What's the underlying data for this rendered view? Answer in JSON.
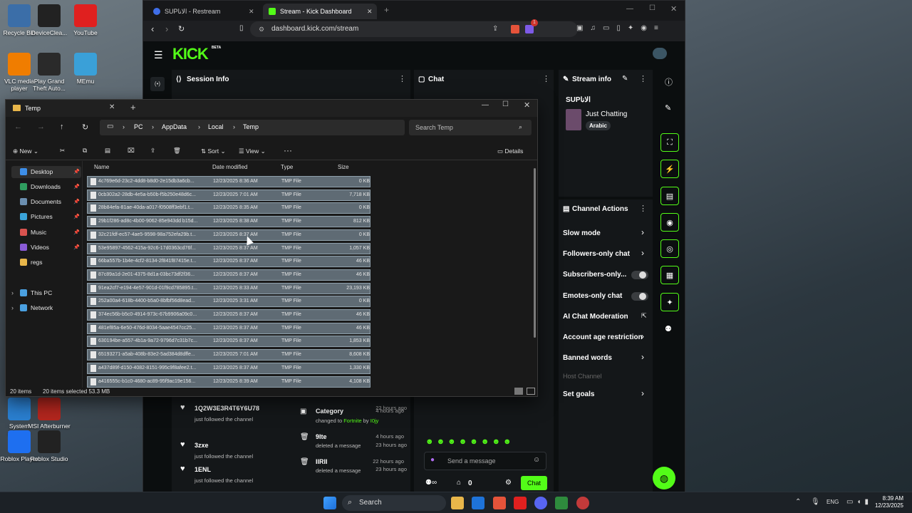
{
  "desktop": {
    "icons_left_top": [
      {
        "label": "Recycle Bin"
      },
      {
        "label": "DeviceClea..."
      },
      {
        "label": "YouTube"
      },
      {
        "label": "VLC media player"
      },
      {
        "label": "Play Grand Theft Auto..."
      },
      {
        "label": "MEmu"
      }
    ],
    "icons_left_bottom": [
      {
        "label": "System Explorer"
      },
      {
        "label": "MSI Afterburner"
      },
      {
        "label": "Roblox Player"
      },
      {
        "label": "Roblox Studio"
      }
    ]
  },
  "browser": {
    "tabs": [
      {
        "title": "SUPالانا - Restream"
      },
      {
        "title": "Stream - Kick Dashboard"
      }
    ],
    "address": "dashboard.kick.com/stream",
    "notification_count": "1"
  },
  "kick": {
    "logo": "KICK",
    "logo_badge": "BETA",
    "session_info": "Session Info",
    "chat_title": "Chat",
    "stream_info_title": "Stream info",
    "stream_title": "SUPالانا",
    "category": "Just Chatting",
    "language": "Arabic",
    "channel_actions_title": "Channel Actions",
    "actions": [
      {
        "label": "Slow mode"
      },
      {
        "label": "Followers-only chat"
      },
      {
        "label": "Subscribers-only..."
      },
      {
        "label": "Emotes-only chat"
      },
      {
        "label": "AI Chat Moderation"
      },
      {
        "label": "Account age restriction"
      },
      {
        "label": "Banned words"
      },
      {
        "label": "Host Channel"
      },
      {
        "label": "Set goals"
      }
    ],
    "followers": [
      {
        "name": "1Q2W3E3R4T6Y6U78",
        "time": "22 hours ago",
        "action": "just followed the channel"
      },
      {
        "name": "3zxe",
        "time": "23 hours ago",
        "action": "just followed the channel"
      },
      {
        "name": "1ENL",
        "time": "23 hours ago",
        "action": "just followed the channel"
      }
    ],
    "events": [
      {
        "title": "Category",
        "time": "4 hours ago",
        "detail_prefix": "changed to",
        "detail_game": "Fortnite",
        "detail_by": "by",
        "detail_user": "I0jy"
      },
      {
        "title": "9Ite",
        "time": "4 hours ago",
        "detail": "deleted a message"
      },
      {
        "title": "IlRII",
        "time": "22 hours ago",
        "detail": "deleted a message"
      }
    ],
    "chat_placeholder": "Send a message",
    "chat_button": "Chat",
    "viewer_count": "0"
  },
  "explorer": {
    "window_title": "Temp",
    "breadcrumb": [
      "PC",
      "AppData",
      "Local",
      "Temp"
    ],
    "search_placeholder": "Search Temp",
    "toolbar": {
      "new": "New",
      "sort": "Sort",
      "view": "View",
      "details": "Details"
    },
    "columns": [
      "Name",
      "Date modified",
      "Type",
      "Size"
    ],
    "nav": [
      {
        "label": "Desktop",
        "color": "#3d8ee8"
      },
      {
        "label": "Downloads",
        "color": "#2f9e5f"
      },
      {
        "label": "Documents",
        "color": "#6b8fb0"
      },
      {
        "label": "Pictures",
        "color": "#3aa3d8"
      },
      {
        "label": "Music",
        "color": "#d9534f"
      },
      {
        "label": "Videos",
        "color": "#8a5bd6"
      },
      {
        "label": "regs",
        "color": "#e8b64a"
      },
      {
        "label": "This PC",
        "color": "#4aa0e0"
      },
      {
        "label": "Network",
        "color": "#4aa0e0"
      }
    ],
    "files": [
      {
        "name": "4c769e6d-23c2-4dd8-b8d0-2e15db3a6cb...",
        "date": "12/23/2025 8:36 AM",
        "type": "TMP File",
        "size": "0 KB"
      },
      {
        "name": "0cb302a2-28db-4e5a-b50b-f5b250e48d6c...",
        "date": "12/23/2025 7:01 AM",
        "type": "TMP File",
        "size": "7,718 KB"
      },
      {
        "name": "28b84efa-81ae-40da-a017-f0508ff3ebf1.t...",
        "date": "12/23/2025 8:35 AM",
        "type": "TMP File",
        "size": "0 KB"
      },
      {
        "name": "29b1f286-ad8c-4b00-9062-85e943dd b15d...",
        "date": "12/23/2025 8:38 AM",
        "type": "TMP File",
        "size": "812 KB"
      },
      {
        "name": "32c21fdf-ec57-4ae5-9598-98a752efa29b.t...",
        "date": "12/23/2025 8:37 AM",
        "type": "TMP File",
        "size": "0 KB"
      },
      {
        "name": "53e95897-4562-415a-92c6-17d0363cd76f...",
        "date": "12/23/2025 8:37 AM",
        "type": "TMP File",
        "size": "1,057 KB"
      },
      {
        "name": "66ba557b-1b4e-4cf2-8134-2f841f87415e.t...",
        "date": "12/23/2025 8:37 AM",
        "type": "TMP File",
        "size": "46 KB"
      },
      {
        "name": "87c89a1d-2e01-4375-8d1a-03bc73df2f36...",
        "date": "12/23/2025 8:37 AM",
        "type": "TMP File",
        "size": "46 KB"
      },
      {
        "name": "91ea2cf7-e194-4e57-901d-01f9cd785895.t...",
        "date": "12/23/2025 8:33 AM",
        "type": "TMP File",
        "size": "23,193 KB"
      },
      {
        "name": "252a00a4-618b-4400-b5a0-8bfbf56d8ead...",
        "date": "12/23/2025 3:31 AM",
        "type": "TMP File",
        "size": "0 KB"
      },
      {
        "name": "374ec56b-b5c0-4914-973c-67b9906a09c0...",
        "date": "12/23/2025 8:37 AM",
        "type": "TMP File",
        "size": "46 KB"
      },
      {
        "name": "481ef85a-6e50-476d-8034-5aae4547cc25...",
        "date": "12/23/2025 8:37 AM",
        "type": "TMP File",
        "size": "46 KB"
      },
      {
        "name": "630194be-a557-4b1a-9a72-9796d7c31b7c...",
        "date": "12/23/2025 8:37 AM",
        "type": "TMP File",
        "size": "1,853 KB"
      },
      {
        "name": "65193271-a5ab-408b-83e2-5ad384d8dffe...",
        "date": "12/23/2025 7:01 AM",
        "type": "TMP File",
        "size": "8,608 KB"
      },
      {
        "name": "a437d89f-d150-4082-8151-995c9f8afee2.t...",
        "date": "12/23/2025 8:37 AM",
        "type": "TMP File",
        "size": "1,330 KB"
      },
      {
        "name": "a416555c-b1c0-4680-ac89-95f9ac19e156...",
        "date": "12/23/2025 8:39 AM",
        "type": "TMP File",
        "size": "4,108 KB"
      }
    ],
    "status": {
      "items": "20 items",
      "selected": "20 items selected 53.3 MB"
    }
  },
  "taskbar": {
    "search": "Search",
    "lang": "ENG",
    "time": "8:39 AM",
    "date": "12/23/2025"
  }
}
